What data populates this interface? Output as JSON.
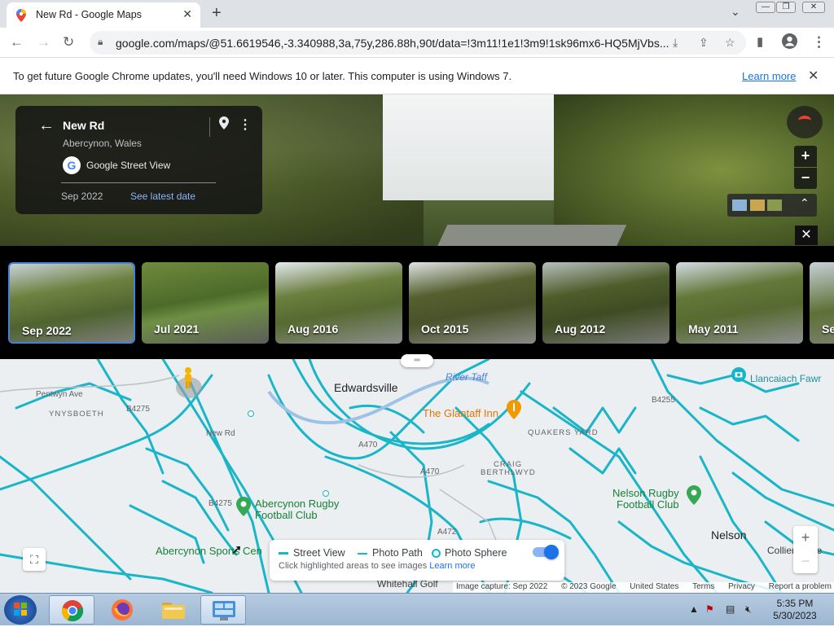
{
  "browser": {
    "tab_title": "New Rd - Google Maps",
    "url": "google.com/maps/@51.6619546,-3.340988,3a,75y,286.88h,90t/data=!3m11!1e1!3m9!1sk96mx6-HQ5MjVbs..."
  },
  "infobar": {
    "message": "To get future Google Chrome updates, you'll need Windows 10 or later. This computer is using Windows 7.",
    "link": "Learn more"
  },
  "card": {
    "name": "New Rd",
    "place": "Abercynon, Wales",
    "source": "Google Street View",
    "date": "Sep 2022",
    "latest_link": "See latest date"
  },
  "timeline": [
    {
      "label": "Sep 2022",
      "selected": true
    },
    {
      "label": "Jul 2021"
    },
    {
      "label": "Aug 2016"
    },
    {
      "label": "Oct 2015"
    },
    {
      "label": "Aug 2012"
    },
    {
      "label": "May 2011"
    },
    {
      "label": "Se"
    }
  ],
  "map": {
    "labels": {
      "edwardsville": "Edwardsville",
      "river_taff": "River Taff",
      "glantaff": "The Glantaff Inn",
      "quakers_yard": "QUAKERS YARD",
      "craig_berthlwyd_1": "CRAIG",
      "craig_berthlwyd_2": "BERTHLWYD",
      "ynysboeth": "YNYSBOETH",
      "pentwyn_ave": "Pentwyn Ave",
      "new_rd": "New Rd",
      "b4275_a": "B4275",
      "b4275_b": "B4275",
      "a470_a": "A470",
      "a470_b": "A470",
      "a472": "A472",
      "b4255": "B4255",
      "abercynon_rugby_1": "Abercynon Rugby",
      "abercynon_rugby_2": "Football Club",
      "nelson_rugby_1": "Nelson Rugby",
      "nelson_rugby_2": "Football Club",
      "nelson": "Nelson",
      "llancaiach": "Llancaiach Fawr",
      "abercynon_sports": "Abercynon Sports Cen",
      "whitehall": "Whitehall Golf",
      "colliers": "Colliers Acre"
    },
    "legend": {
      "street_view": "Street View",
      "photo_path": "Photo Path",
      "photo_sphere": "Photo Sphere",
      "hint": "Click highlighted areas to see images",
      "learn_more": "Learn more",
      "toggle_on": true
    },
    "footer": {
      "capture": "Image capture: Sep 2022",
      "copyright": "© 2023 Google",
      "region": "United States",
      "terms": "Terms",
      "privacy": "Privacy",
      "report": "Report a problem"
    }
  },
  "taskbar": {
    "time": "5:35 PM",
    "date": "5/30/2023"
  },
  "colors": {
    "coverage": "#19b5c8",
    "accent": "#1a73e8"
  }
}
